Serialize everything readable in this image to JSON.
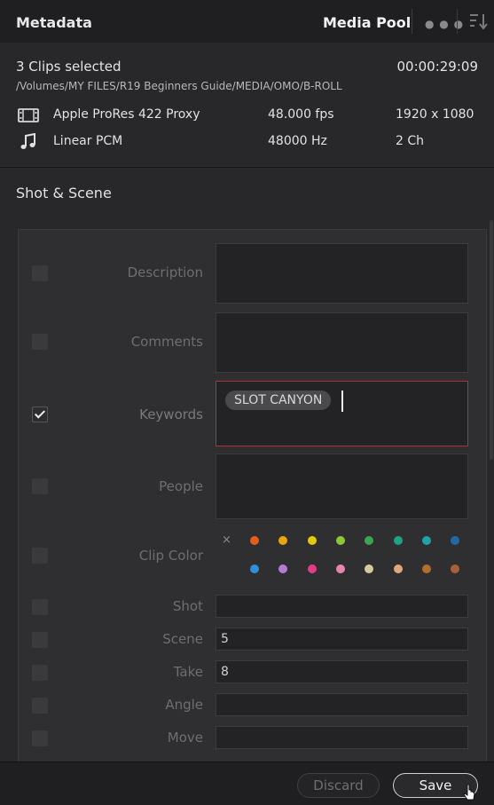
{
  "header": {
    "title": "Metadata",
    "media_pool_label": "Media Pool",
    "more_icon": "ellipsis-icon",
    "sort_icon": "sort-descending-icon"
  },
  "clip_info": {
    "selection_text": "3 Clips selected",
    "timecode": "00:00:29:09",
    "path": "/Volumes/MY FILES/R19 Beginners Guide/MEDIA/OMO/B-ROLL",
    "video": {
      "icon": "film-icon",
      "codec": "Apple ProRes 422 Proxy",
      "fps": "48.000 fps",
      "resolution": "1920 x 1080"
    },
    "audio": {
      "icon": "music-note-icon",
      "codec": "Linear PCM",
      "rate": "48000 Hz",
      "channels": "2 Ch"
    }
  },
  "section": {
    "title": "Shot & Scene",
    "fields": {
      "description": {
        "label": "Description",
        "value": "",
        "checked": false
      },
      "comments": {
        "label": "Comments",
        "value": "",
        "checked": false
      },
      "keywords": {
        "label": "Keywords",
        "tag": "SLOT CANYON",
        "checked": true
      },
      "people": {
        "label": "People",
        "value": "",
        "checked": false
      },
      "clip_color": {
        "label": "Clip Color",
        "clear_symbol": "×",
        "checked": false
      },
      "shot": {
        "label": "Shot",
        "value": "",
        "checked": false
      },
      "scene": {
        "label": "Scene",
        "value": "5",
        "checked": false
      },
      "take": {
        "label": "Take",
        "value": "8",
        "checked": false
      },
      "angle": {
        "label": "Angle",
        "value": "",
        "checked": false
      },
      "move": {
        "label": "Move",
        "value": "",
        "checked": false
      }
    },
    "clip_colors": [
      "#e0601e",
      "#e8a50c",
      "#e6c80a",
      "#8cc63a",
      "#3aa655",
      "#1fa283",
      "#1fa3a8",
      "#1f6aa6",
      "#2e8ed6",
      "#b57ad1",
      "#e03d86",
      "#e684b0",
      "#d6c9a0",
      "#e0a87a",
      "#b06e2a",
      "#a86038"
    ]
  },
  "footer": {
    "discard_label": "Discard",
    "save_label": "Save"
  },
  "colors": {
    "accent_active_field": "#b0342e",
    "panel_bg": "#28282a"
  }
}
